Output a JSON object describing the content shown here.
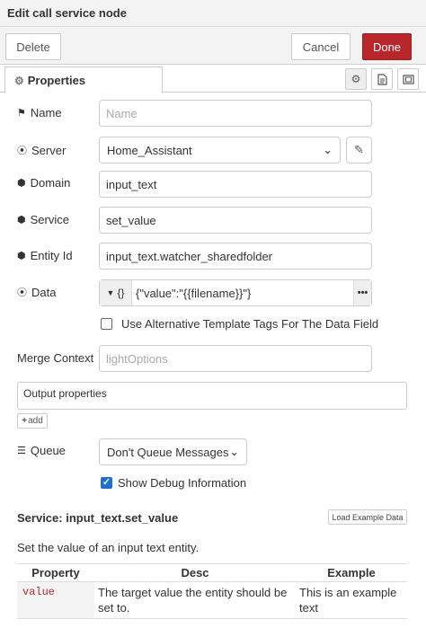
{
  "title": "Edit call service node",
  "actions": {
    "delete": "Delete",
    "cancel": "Cancel",
    "done": "Done"
  },
  "tabs": {
    "properties": "Properties"
  },
  "fields": {
    "name": {
      "label": "Name",
      "placeholder": "Name",
      "value": ""
    },
    "server": {
      "label": "Server",
      "value": "Home_Assistant"
    },
    "domain": {
      "label": "Domain",
      "value": "input_text"
    },
    "service": {
      "label": "Service",
      "value": "set_value"
    },
    "entity_id": {
      "label": "Entity Id",
      "value": "input_text.watcher_sharedfolder"
    },
    "data": {
      "label": "Data",
      "type_label": "{}",
      "value": "{\"value\":\"{{filename}}\"}"
    },
    "alt_tags": {
      "label": "Use Alternative Template Tags For The Data Field",
      "checked": false
    },
    "merge_context": {
      "label": "Merge Context",
      "placeholder": "lightOptions"
    },
    "output_properties": {
      "label": "Output properties"
    },
    "add": "add",
    "queue": {
      "label": "Queue",
      "value": "Don't Queue Messages"
    },
    "debug": {
      "label": "Show Debug Information",
      "checked": true
    }
  },
  "service_info": {
    "title": "Service: input_text.set_value",
    "load_example": "Load Example Data",
    "description": "Set the value of an input text entity.",
    "table": {
      "headers": [
        "Property",
        "Desc",
        "Example"
      ],
      "rows": [
        {
          "property": "value",
          "desc": "The target value the entity should be set to.",
          "example": "This is an example text"
        }
      ]
    }
  }
}
